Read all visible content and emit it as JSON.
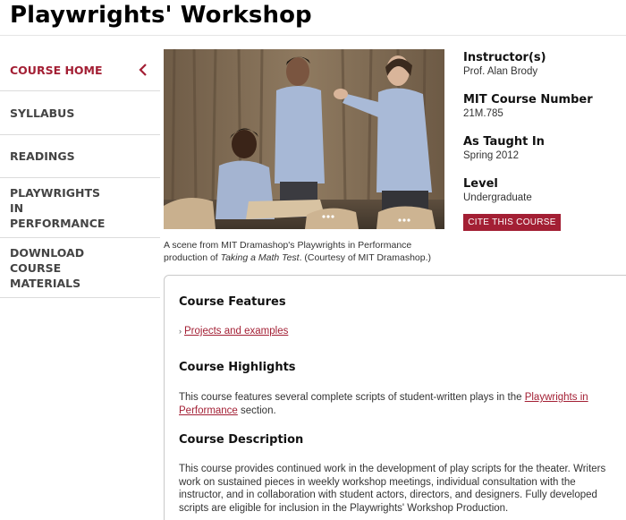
{
  "page_title": "Playwrights' Workshop",
  "sidebar": {
    "items": [
      {
        "label": "COURSE HOME",
        "active": true
      },
      {
        "label": "SYLLABUS"
      },
      {
        "label": "READINGS"
      },
      {
        "label": "PLAYWRIGHTS IN PERFORMANCE"
      },
      {
        "label": "DOWNLOAD COURSE MATERIALS"
      }
    ]
  },
  "caption": {
    "line1": "A scene from MIT Dramashop's Playwrights in Performance",
    "line2_prefix": "production of ",
    "play_title": "Taking a Math Test",
    "line2_suffix": ". (Courtesy of MIT Dramashop.)"
  },
  "info": {
    "instructor_label": "Instructor(s)",
    "instructor": "Prof. Alan Brody",
    "number_label": "MIT Course Number",
    "number": "21M.785",
    "taught_label": "As Taught In",
    "taught": "Spring 2012",
    "level_label": "Level",
    "level": "Undergraduate",
    "cite_button": "CITE THIS COURSE"
  },
  "course": {
    "features_heading": "Course Features",
    "feature_link": "Projects and examples",
    "highlights_heading": "Course Highlights",
    "highlights_prefix": "This course features several complete scripts of student-written plays in the ",
    "highlights_link": "Playwrights in Performance",
    "highlights_suffix": " section.",
    "description_heading": "Course Description",
    "description": "This course provides continued work in the development of play scripts for the theater. Writers work on sustained pieces in weekly workshop meetings, individual consultation with the instructor, and in collaboration with student actors, directors, and designers. Fully developed scripts are eligible for inclusion in the Playwrights' Workshop Production."
  },
  "colors": {
    "accent": "#a31f34"
  }
}
